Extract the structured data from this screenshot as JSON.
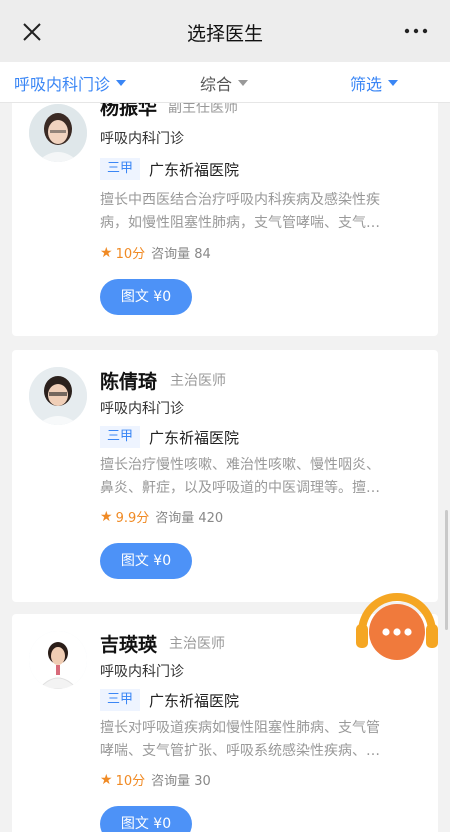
{
  "header": {
    "title": "选择医生"
  },
  "filters": {
    "department": "呼吸内科门诊",
    "sort": "综合",
    "filter": "筛选"
  },
  "doctors": [
    {
      "name": "杨振华",
      "rank": "副主任医师",
      "dept": "呼吸内科门诊",
      "tag": "三甲",
      "hospital": "广东祈福医院",
      "desc1": "擅长中西医结合治疗呼吸内科疾病及感染性疾",
      "desc2": "病，如慢性阻塞性肺病，支气管哮喘、支气…",
      "score": "10分",
      "count": "咨询量 84",
      "button": "图文 ¥0"
    },
    {
      "name": "陈倩琦",
      "rank": "主治医师",
      "dept": "呼吸内科门诊",
      "tag": "三甲",
      "hospital": "广东祈福医院",
      "desc1": "擅长治疗慢性咳嗽、难治性咳嗽、慢性咽炎、",
      "desc2": "鼻炎、鼾症，以及呼吸道的中医调理等。擅…",
      "score": "9.9分",
      "count": "咨询量 420",
      "button": "图文 ¥0"
    },
    {
      "name": "吉瑛瑛",
      "rank": "主治医师",
      "dept": "呼吸内科门诊",
      "tag": "三甲",
      "hospital": "广东祈福医院",
      "desc1": "擅长对呼吸道疾病如慢性阻塞性肺病、支气管",
      "desc2": "哮喘、支气管扩张、呼吸系统感染性疾病、…",
      "score": "10分",
      "count": "咨询量 30",
      "button": "图文 ¥0"
    }
  ],
  "colors": {
    "accent": "#3a86f5",
    "star": "#f08a24",
    "button": "#4d92f7",
    "float": "#f07a3c"
  }
}
